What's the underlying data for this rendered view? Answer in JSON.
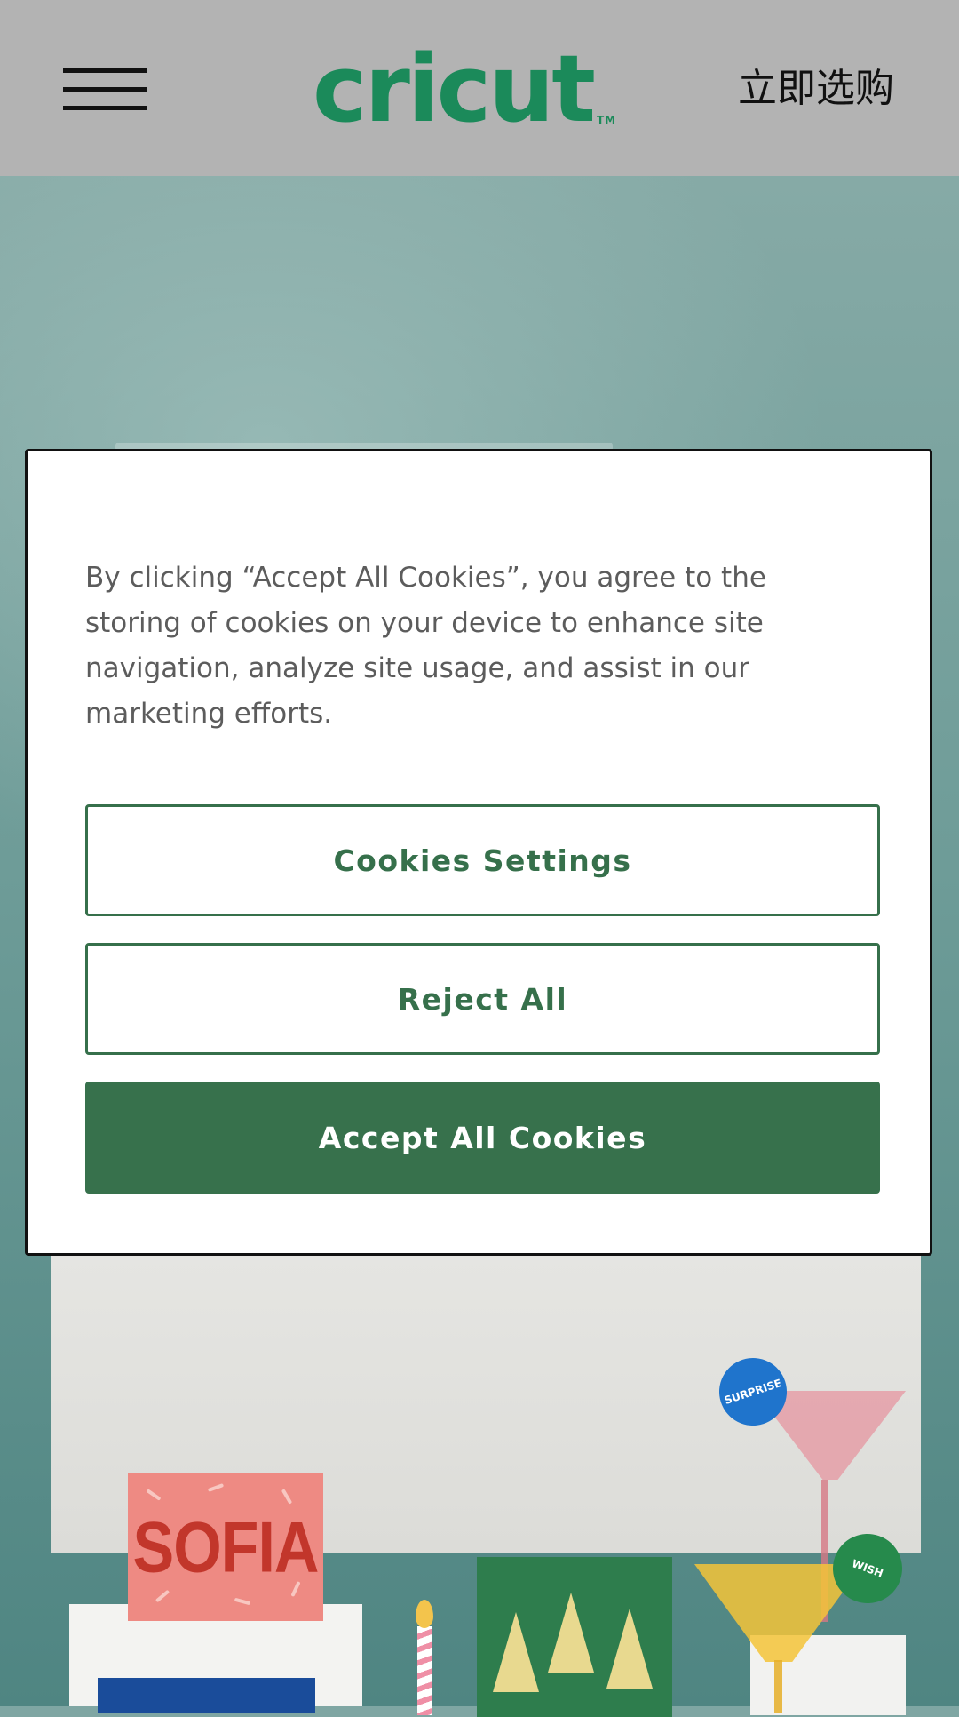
{
  "header": {
    "menu_icon": "hamburger-menu-icon",
    "logo_text": "cricut",
    "logo_tm": "TM",
    "shop_now": "立即选购"
  },
  "hero": {
    "sofia_card_text": "SOFIA",
    "sticker_surprise": "SURPRISE",
    "sticker_wish": "WISH"
  },
  "cookie_banner": {
    "message": "By clicking “Accept All Cookies”, you agree to the storing of cookies on your device to enhance site navigation, analyze site usage, and assist in our marketing efforts.",
    "settings_label": "Cookies Settings",
    "reject_label": "Reject All",
    "accept_label": "Accept All Cookies"
  },
  "colors": {
    "brand_green": "#1b8a5a",
    "button_green": "#37714c",
    "header_bg": "#b3b3b3"
  }
}
